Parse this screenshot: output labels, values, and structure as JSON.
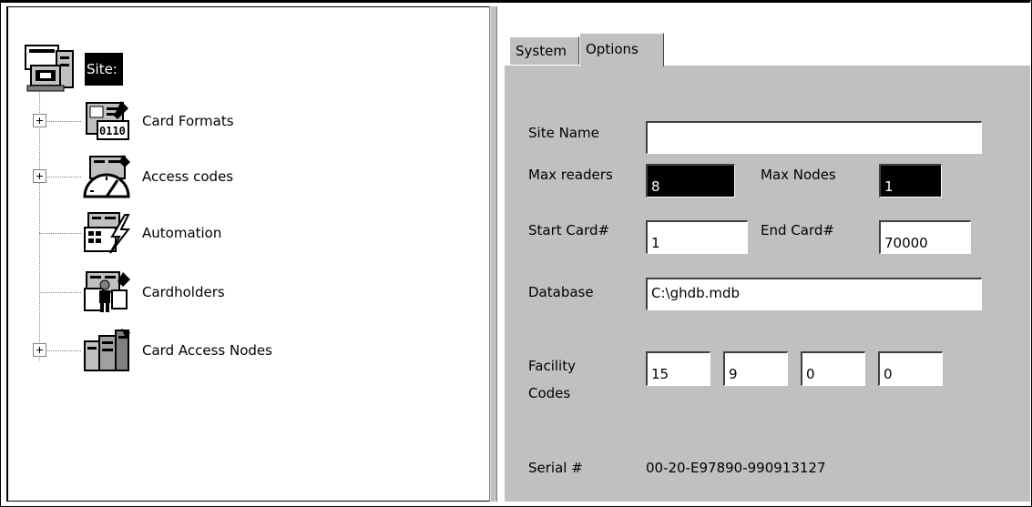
{
  "tree": {
    "root": {
      "label": "Site:",
      "icon": "site-computer-icon"
    },
    "nodes": [
      {
        "label": "Card Formats",
        "icon": "card-format-icon",
        "expandable": true
      },
      {
        "label": "Access codes",
        "icon": "clock-gauge-icon",
        "expandable": true
      },
      {
        "label": "Automation",
        "icon": "lightning-automation-icon",
        "expandable": false
      },
      {
        "label": "Cardholders",
        "icon": "cardholder-person-icon",
        "expandable": false
      },
      {
        "label": "Card Access Nodes",
        "icon": "access-node-cabinet-icon",
        "expandable": true
      }
    ]
  },
  "tabs": {
    "system": "System",
    "options": "Options",
    "active": "options"
  },
  "form": {
    "site_name_label": "Site Name",
    "site_name_value": "",
    "max_readers_label": "Max readers",
    "max_readers_value": "8",
    "max_nodes_label": "Max Nodes",
    "max_nodes_value": "1",
    "start_card_label": "Start Card#",
    "start_card_value": "1",
    "end_card_label": "End Card#",
    "end_card_value": "70000",
    "database_label": "Database",
    "database_value": "C:\\ghdb.mdb",
    "facility_label_line1": "Facility",
    "facility_label_line2": "Codes",
    "facility_codes": [
      "15",
      "9",
      "0",
      "0"
    ],
    "serial_label": "Serial #",
    "serial_value": "00-20-E97890-990913127"
  },
  "colors": {
    "face": "#c0c0c0",
    "shadow": "#404040",
    "highlight": "#ffffff",
    "selection": "#000000"
  }
}
